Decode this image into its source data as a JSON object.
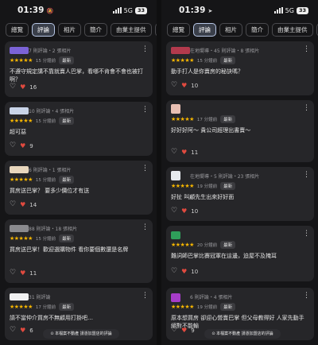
{
  "tabs": [
    "總覽",
    "評論",
    "相片",
    "簡介",
    "由業主提供",
    "服務"
  ],
  "active_tab_index": 1,
  "colors": {
    "star": "#f4b400",
    "heart_react": "#e04a3f",
    "active_tab_border": "#b8c7e6"
  },
  "left": {
    "status": {
      "time": "01:39",
      "indicator": "🔕",
      "network": "5G",
      "battery": "33"
    },
    "reviews": [
      {
        "avatar_color": "#7b63d6",
        "meta": "7 則評論・2 張相片",
        "stars": "★★★★★",
        "date": "15 分鐘前",
        "badge": "最新",
        "text": "不遵守規定講不靠就賣人巴掌，看哪不肯會不會也被打啊？",
        "likes": "16"
      },
      {
        "avatar_color": "#c9d4e8",
        "meta": "10 則評論・4 張相片",
        "stars": "★★★★★",
        "date": "15 分鐘前",
        "badge": "最新",
        "text": "超可惡",
        "likes": "9"
      },
      {
        "avatar_color": "#e9d7bd",
        "meta": "6 則評論・1 張相片",
        "stars": "★★★★★",
        "date": "15 分鐘前",
        "badge": "最新",
        "text": "買房送巴掌？ 要多少價位才有送",
        "likes": "14"
      },
      {
        "avatar_color": "#8a8a8e",
        "meta": "88 則評論・18 張相片",
        "stars": "★★★★★",
        "date": "15 分鐘前",
        "badge": "最新",
        "text": "買房送巴掌！歡迎選購物件 看你要個數還是名牌",
        "likes": "11"
      },
      {
        "avatar_color": "#f2f2f2",
        "meta": "31 則評論",
        "stars": "★★★★★",
        "date": "17 分鐘前",
        "badge": "最新",
        "text": "請不當仲介買房不無顧用打掛吧…",
        "likes": "6"
      }
    ],
    "toast": "⊙ 本檔案不動產 請憑加盟店的評論"
  },
  "right": {
    "status": {
      "time": "01:39",
      "indicator": "➤",
      "network": "5G",
      "battery": "33"
    },
    "reviews": [
      {
        "avatar_color": "#b23a4d",
        "meta": "在地嚮導・45 則評論・8 張相片",
        "stars": "★★★★★",
        "date": "15 分鐘前",
        "badge": "最新",
        "text": "動手打人是你賣房的秘訣嗎？",
        "likes": "10"
      },
      {
        "avatar_color": "#e8bfb3",
        "meta": "",
        "stars": "★★★★★",
        "date": "17 分鐘前",
        "badge": "最新",
        "text": "好好好阿～ 貴公司經理出書賣～",
        "likes": "11"
      },
      {
        "avatar_color": "#e6e9ee",
        "meta": "在地嚮導・5 則評論・23 張相片",
        "stars": "★★★★★",
        "date": "19 分鐘前",
        "badge": "最新",
        "text": "好扯 叫顧先生出來好好面",
        "likes": "10"
      },
      {
        "avatar_color": "#2f9e5a",
        "meta": "",
        "stars": "★★★★★",
        "date": "20 分鐘前",
        "badge": "最新",
        "text": "難詞師巴掌比賽冠軍在這邊，迫屋不及掩耳",
        "likes": "10"
      },
      {
        "avatar_color": "#a63cc8",
        "meta": "6 則評論・4 張相片",
        "stars": "★★★★★",
        "date": "19 分鐘前",
        "badge": "最新",
        "text": "原本想買房 卻迎心營賣巴掌 但父母教得好 人家先動手 絕對不能輸",
        "likes": "9"
      }
    ]
  }
}
